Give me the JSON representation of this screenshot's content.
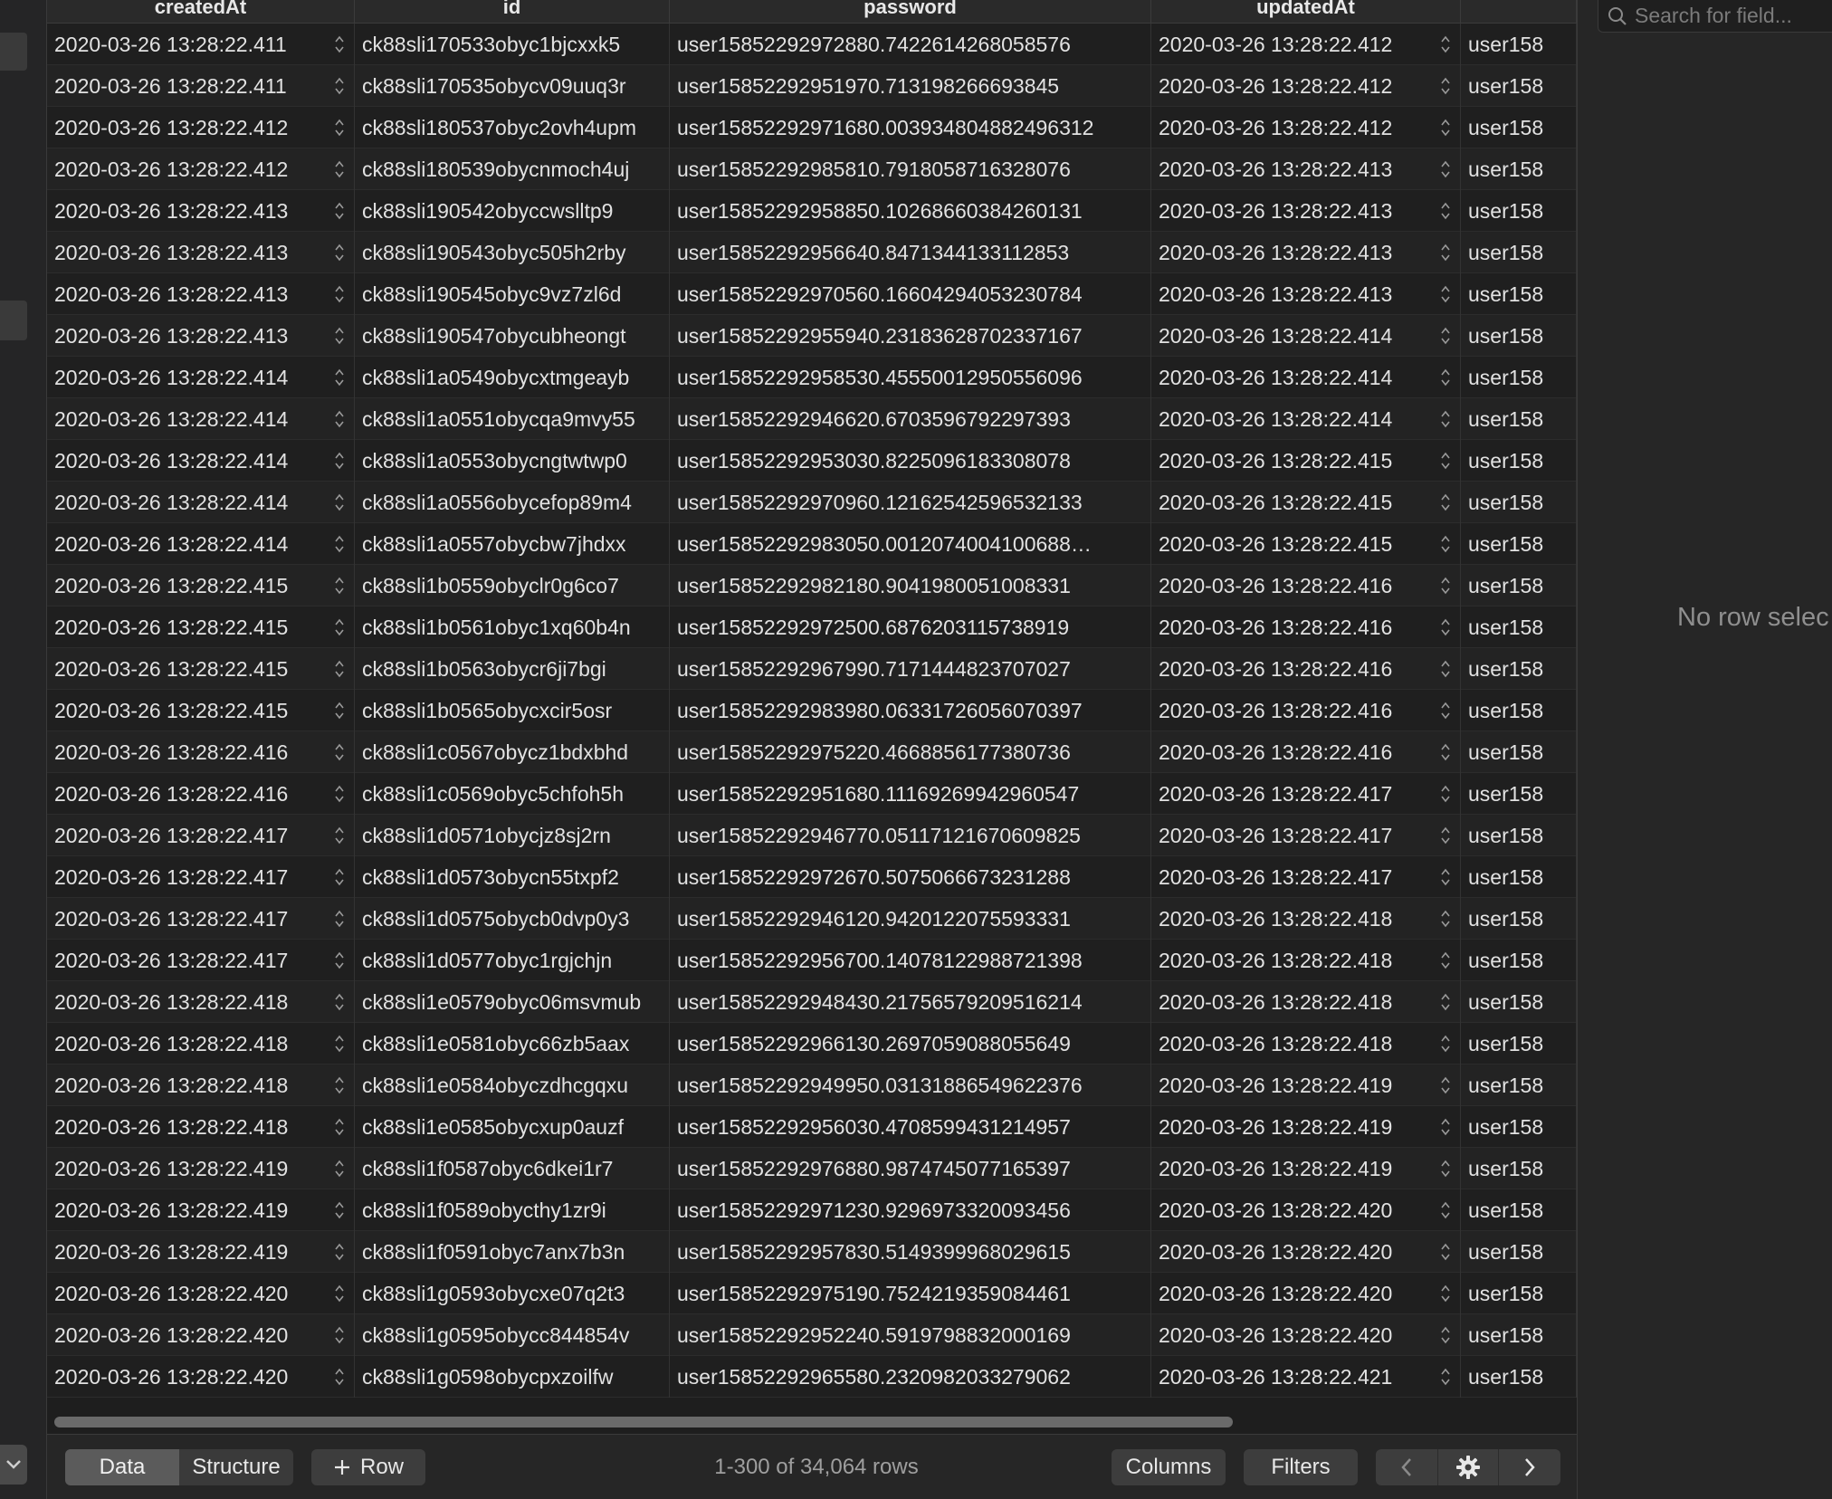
{
  "columns": [
    "createdAt",
    "id",
    "password",
    "updatedAt",
    ""
  ],
  "rows": [
    {
      "createdAt": "2020-03-26 13:28:22.411",
      "id": "ck88sli170533obyc1bjcxxk5",
      "password": "user15852292972880.7422614268058576",
      "updatedAt": "2020-03-26 13:28:22.412",
      "username": "user158"
    },
    {
      "createdAt": "2020-03-26 13:28:22.411",
      "id": "ck88sli170535obycv09uuq3r",
      "password": "user15852292951970.713198266693845",
      "updatedAt": "2020-03-26 13:28:22.412",
      "username": "user158"
    },
    {
      "createdAt": "2020-03-26 13:28:22.412",
      "id": "ck88sli180537obyc2ovh4upm",
      "password": "user15852292971680.003934804882496312",
      "updatedAt": "2020-03-26 13:28:22.412",
      "username": "user158"
    },
    {
      "createdAt": "2020-03-26 13:28:22.412",
      "id": "ck88sli180539obycnmoch4uj",
      "password": "user15852292985810.7918058716328076",
      "updatedAt": "2020-03-26 13:28:22.413",
      "username": "user158"
    },
    {
      "createdAt": "2020-03-26 13:28:22.413",
      "id": "ck88sli190542obyccwslltp9",
      "password": "user15852292958850.10268660384260131",
      "updatedAt": "2020-03-26 13:28:22.413",
      "username": "user158"
    },
    {
      "createdAt": "2020-03-26 13:28:22.413",
      "id": "ck88sli190543obyc505h2rby",
      "password": "user15852292956640.8471344133112853",
      "updatedAt": "2020-03-26 13:28:22.413",
      "username": "user158"
    },
    {
      "createdAt": "2020-03-26 13:28:22.413",
      "id": "ck88sli190545obyc9vz7zl6d",
      "password": "user15852292970560.16604294053230784",
      "updatedAt": "2020-03-26 13:28:22.413",
      "username": "user158"
    },
    {
      "createdAt": "2020-03-26 13:28:22.413",
      "id": "ck88sli190547obycubheongt",
      "password": "user15852292955940.23183628702337167",
      "updatedAt": "2020-03-26 13:28:22.414",
      "username": "user158"
    },
    {
      "createdAt": "2020-03-26 13:28:22.414",
      "id": "ck88sli1a0549obycxtmgeayb",
      "password": "user15852292958530.45550012950556096",
      "updatedAt": "2020-03-26 13:28:22.414",
      "username": "user158"
    },
    {
      "createdAt": "2020-03-26 13:28:22.414",
      "id": "ck88sli1a0551obycqa9mvy55",
      "password": "user15852292946620.6703596792297393",
      "updatedAt": "2020-03-26 13:28:22.414",
      "username": "user158"
    },
    {
      "createdAt": "2020-03-26 13:28:22.414",
      "id": "ck88sli1a0553obycngtwtwp0",
      "password": "user15852292953030.8225096183308078",
      "updatedAt": "2020-03-26 13:28:22.415",
      "username": "user158"
    },
    {
      "createdAt": "2020-03-26 13:28:22.414",
      "id": "ck88sli1a0556obycefop89m4",
      "password": "user15852292970960.12162542596532133",
      "updatedAt": "2020-03-26 13:28:22.415",
      "username": "user158"
    },
    {
      "createdAt": "2020-03-26 13:28:22.414",
      "id": "ck88sli1a0557obycbw7jhdxx",
      "password": "user15852292983050.0012074004100688…",
      "updatedAt": "2020-03-26 13:28:22.415",
      "username": "user158"
    },
    {
      "createdAt": "2020-03-26 13:28:22.415",
      "id": "ck88sli1b0559obyclr0g6co7",
      "password": "user15852292982180.9041980051008331",
      "updatedAt": "2020-03-26 13:28:22.416",
      "username": "user158"
    },
    {
      "createdAt": "2020-03-26 13:28:22.415",
      "id": "ck88sli1b0561obyc1xq60b4n",
      "password": "user15852292972500.6876203115738919",
      "updatedAt": "2020-03-26 13:28:22.416",
      "username": "user158"
    },
    {
      "createdAt": "2020-03-26 13:28:22.415",
      "id": "ck88sli1b0563obycr6ji7bgi",
      "password": "user15852292967990.7171444823707027",
      "updatedAt": "2020-03-26 13:28:22.416",
      "username": "user158"
    },
    {
      "createdAt": "2020-03-26 13:28:22.415",
      "id": "ck88sli1b0565obycxcir5osr",
      "password": "user15852292983980.06331726056070397",
      "updatedAt": "2020-03-26 13:28:22.416",
      "username": "user158"
    },
    {
      "createdAt": "2020-03-26 13:28:22.416",
      "id": "ck88sli1c0567obycz1bdxbhd",
      "password": "user15852292975220.4668856177380736",
      "updatedAt": "2020-03-26 13:28:22.416",
      "username": "user158"
    },
    {
      "createdAt": "2020-03-26 13:28:22.416",
      "id": "ck88sli1c0569obyc5chfoh5h",
      "password": "user15852292951680.11169269942960547",
      "updatedAt": "2020-03-26 13:28:22.417",
      "username": "user158"
    },
    {
      "createdAt": "2020-03-26 13:28:22.417",
      "id": "ck88sli1d0571obycjz8sj2rn",
      "password": "user15852292946770.05117121670609825",
      "updatedAt": "2020-03-26 13:28:22.417",
      "username": "user158"
    },
    {
      "createdAt": "2020-03-26 13:28:22.417",
      "id": "ck88sli1d0573obycn55txpf2",
      "password": "user15852292972670.5075066673231288",
      "updatedAt": "2020-03-26 13:28:22.417",
      "username": "user158"
    },
    {
      "createdAt": "2020-03-26 13:28:22.417",
      "id": "ck88sli1d0575obycb0dvp0y3",
      "password": "user15852292946120.9420122075593331",
      "updatedAt": "2020-03-26 13:28:22.418",
      "username": "user158"
    },
    {
      "createdAt": "2020-03-26 13:28:22.417",
      "id": "ck88sli1d0577obyc1rgjchjn",
      "password": "user15852292956700.14078122988721398",
      "updatedAt": "2020-03-26 13:28:22.418",
      "username": "user158"
    },
    {
      "createdAt": "2020-03-26 13:28:22.418",
      "id": "ck88sli1e0579obyc06msvmub",
      "password": "user15852292948430.21756579209516214",
      "updatedAt": "2020-03-26 13:28:22.418",
      "username": "user158"
    },
    {
      "createdAt": "2020-03-26 13:28:22.418",
      "id": "ck88sli1e0581obyc66zb5aax",
      "password": "user15852292966130.2697059088055649",
      "updatedAt": "2020-03-26 13:28:22.418",
      "username": "user158"
    },
    {
      "createdAt": "2020-03-26 13:28:22.418",
      "id": "ck88sli1e0584obyczdhcgqxu",
      "password": "user15852292949950.03131886549622376",
      "updatedAt": "2020-03-26 13:28:22.419",
      "username": "user158"
    },
    {
      "createdAt": "2020-03-26 13:28:22.418",
      "id": "ck88sli1e0585obycxup0auzf",
      "password": "user15852292956030.4708599431214957",
      "updatedAt": "2020-03-26 13:28:22.419",
      "username": "user158"
    },
    {
      "createdAt": "2020-03-26 13:28:22.419",
      "id": "ck88sli1f0587obyc6dkei1r7",
      "password": "user15852292976880.9874745077165397",
      "updatedAt": "2020-03-26 13:28:22.419",
      "username": "user158"
    },
    {
      "createdAt": "2020-03-26 13:28:22.419",
      "id": "ck88sli1f0589obycthy1zr9i",
      "password": "user15852292971230.9296973320093456",
      "updatedAt": "2020-03-26 13:28:22.420",
      "username": "user158"
    },
    {
      "createdAt": "2020-03-26 13:28:22.419",
      "id": "ck88sli1f0591obyc7anx7b3n",
      "password": "user15852292957830.5149399968029615",
      "updatedAt": "2020-03-26 13:28:22.420",
      "username": "user158"
    },
    {
      "createdAt": "2020-03-26 13:28:22.420",
      "id": "ck88sli1g0593obycxe07q2t3",
      "password": "user15852292975190.7524219359084461",
      "updatedAt": "2020-03-26 13:28:22.420",
      "username": "user158"
    },
    {
      "createdAt": "2020-03-26 13:28:22.420",
      "id": "ck88sli1g0595obycc844854v",
      "password": "user15852292952240.5919798832000169",
      "updatedAt": "2020-03-26 13:28:22.420",
      "username": "user158"
    },
    {
      "createdAt": "2020-03-26 13:28:22.420",
      "id": "ck88sli1g0598obycpxzoilfw",
      "password": "user15852292965580.2320982033279062",
      "updatedAt": "2020-03-26 13:28:22.421",
      "username": "user158"
    }
  ],
  "toolbar": {
    "data_tab": "Data",
    "structure_tab": "Structure",
    "add_row": "Row",
    "row_count": "1-300 of 34,064 rows",
    "columns_button": "Columns",
    "filters_button": "Filters"
  },
  "inspector": {
    "search_placeholder": "Search for field...",
    "empty_message": "No row selec"
  },
  "icons": {
    "prev": "chevron-left-icon",
    "settings": "gear-icon",
    "next": "chevron-right-icon",
    "search": "search-icon",
    "plus": "plus-icon",
    "dropdown": "chevron-down-icon"
  }
}
